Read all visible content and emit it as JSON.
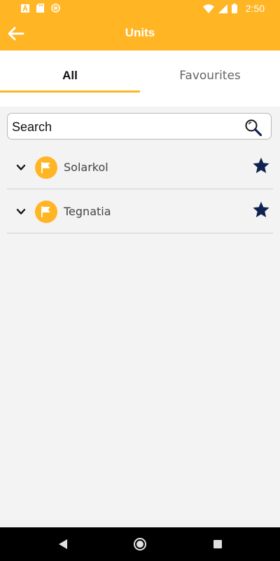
{
  "status_bar": {
    "time": "2:50",
    "icons": [
      "notification-a-icon",
      "sd-card-icon",
      "circle-icon",
      "wifi-icon",
      "signal-icon",
      "battery-icon"
    ]
  },
  "app_bar": {
    "title": "Units",
    "back_icon": "arrow-left-icon",
    "background": "#ffb524"
  },
  "tabs": [
    {
      "label": "All",
      "selected": true
    },
    {
      "label": "Favourites",
      "selected": false
    }
  ],
  "search": {
    "placeholder": "Search",
    "value": "",
    "icon": "search-icon"
  },
  "units": [
    {
      "name": "Solarkol",
      "favourite": true,
      "icon": "flag-icon"
    },
    {
      "name": "Tegnatia",
      "favourite": true,
      "icon": "flag-icon"
    }
  ],
  "colors": {
    "accent": "#ffb524",
    "star": "#0e2250"
  },
  "nav_bar": {
    "buttons": [
      "back-triangle-icon",
      "home-circle-icon",
      "recents-square-icon"
    ]
  }
}
